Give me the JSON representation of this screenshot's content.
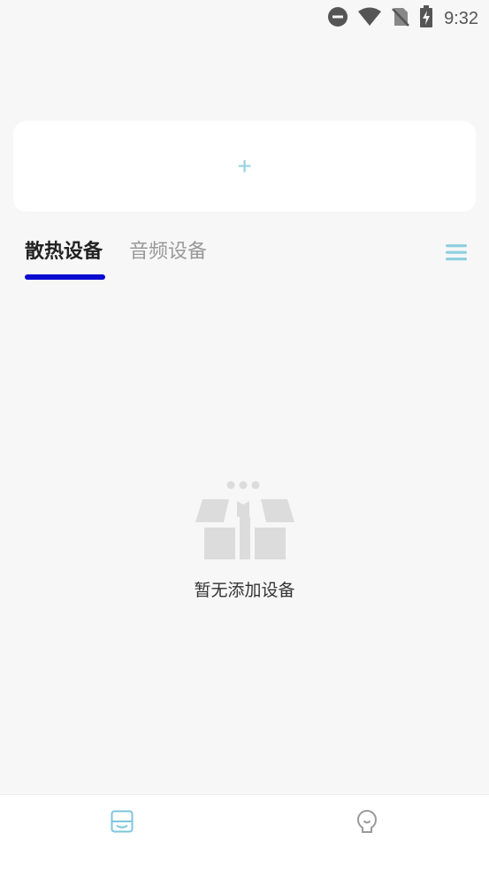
{
  "status_bar": {
    "time": "9:32",
    "icons": [
      "do-not-disturb-icon",
      "wifi-icon",
      "no-sim-icon",
      "battery-charging-icon"
    ]
  },
  "add_card": {
    "label": "+"
  },
  "tabs": [
    {
      "label": "散热设备",
      "active": true
    },
    {
      "label": "音频设备",
      "active": false
    }
  ],
  "menu": {
    "icon": "menu-icon"
  },
  "empty_state": {
    "icon": "empty-box-icon",
    "text": "暂无添加设备"
  },
  "bottom_nav": {
    "items": [
      {
        "icon": "device-tray-icon",
        "active": true
      },
      {
        "icon": "profile-icon",
        "active": false
      }
    ]
  },
  "colors": {
    "accent": "#8fd0e0",
    "tab_indicator": "#0b0bd0",
    "background": "#f7f7f7"
  }
}
